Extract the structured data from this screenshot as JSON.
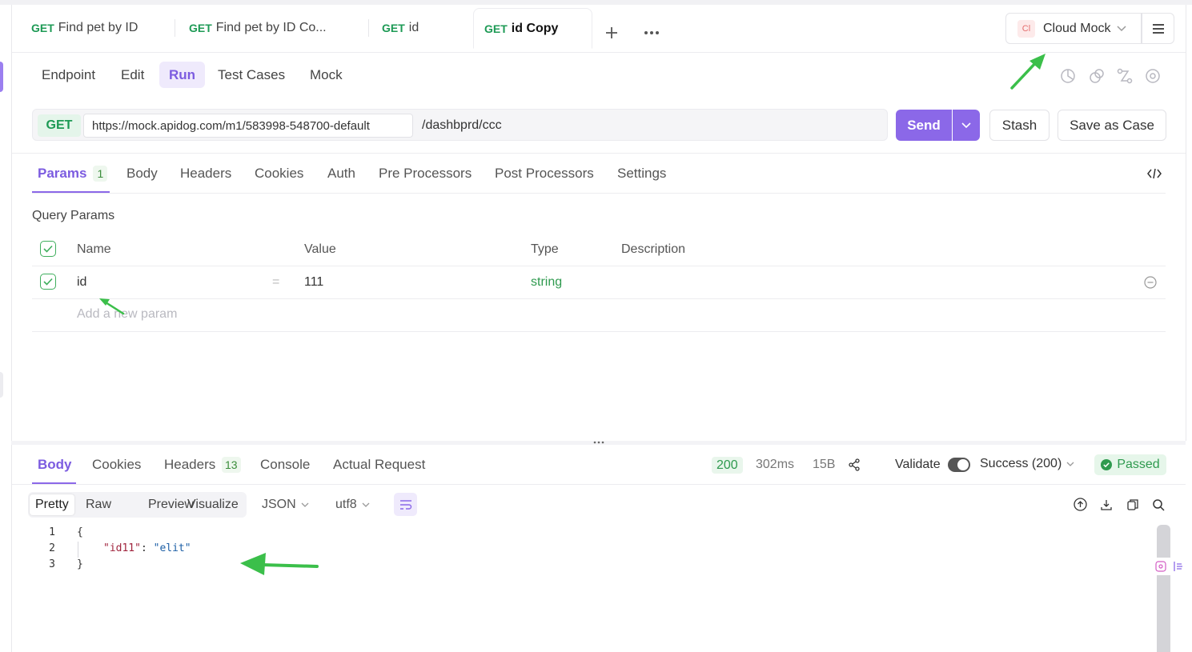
{
  "tabs": [
    {
      "method": "GET",
      "title": "Find pet by ID"
    },
    {
      "method": "GET",
      "title": "Find pet by ID Co..."
    },
    {
      "method": "GET",
      "title": "id"
    },
    {
      "method": "GET",
      "title": "id Copy"
    }
  ],
  "environment": {
    "badge": "Cl",
    "label": "Cloud Mock"
  },
  "subtabs": [
    "Endpoint",
    "Edit",
    "Run",
    "Test Cases",
    "Mock"
  ],
  "request": {
    "method": "GET",
    "base_url": "https://mock.apidog.com/m1/583998-548700-default",
    "path": "/dashbprd/ccc",
    "send_label": "Send",
    "stash_label": "Stash",
    "save_case_label": "Save as Case"
  },
  "param_tabs": [
    {
      "label": "Params",
      "count": "1"
    },
    {
      "label": "Body"
    },
    {
      "label": "Headers"
    },
    {
      "label": "Cookies"
    },
    {
      "label": "Auth"
    },
    {
      "label": "Pre Processors"
    },
    {
      "label": "Post Processors"
    },
    {
      "label": "Settings"
    }
  ],
  "query_params": {
    "section_label": "Query Params",
    "columns": {
      "name": "Name",
      "value": "Value",
      "type": "Type",
      "description": "Description"
    },
    "rows": [
      {
        "name": "id",
        "sep": "=",
        "value": "111",
        "type": "string",
        "description": ""
      }
    ],
    "add_placeholder": "Add a new param"
  },
  "response": {
    "tabs": [
      {
        "label": "Body"
      },
      {
        "label": "Cookies"
      },
      {
        "label": "Headers",
        "count": "13"
      },
      {
        "label": "Console"
      },
      {
        "label": "Actual Request"
      }
    ],
    "status": "200",
    "time": "302ms",
    "size": "15B",
    "validate_label": "Validate",
    "validate_on": true,
    "schema_select": "Success (200)",
    "result": "Passed",
    "view_modes": [
      "Pretty",
      "Raw",
      "Preview",
      "Visualize"
    ],
    "format": "JSON",
    "encoding": "utf8",
    "body_lines": [
      {
        "n": "1",
        "open": "{"
      },
      {
        "n": "2",
        "key": "\"id11\"",
        "colon": ": ",
        "val": "\"elit\""
      },
      {
        "n": "3",
        "close": "}"
      }
    ]
  },
  "colors": {
    "accent": "#8b68e8",
    "get_green": "#1d9a55",
    "pass_green": "#2f9a4f",
    "annotation_arrow": "#3bbf4a"
  }
}
